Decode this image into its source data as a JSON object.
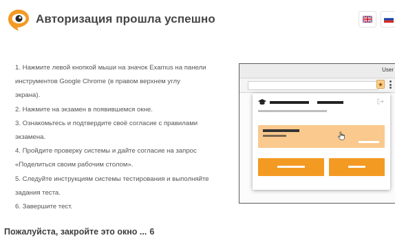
{
  "header": {
    "title": "Авторизация прошла успешно",
    "languages": [
      {
        "code": "en",
        "icon": "uk-flag-icon"
      },
      {
        "code": "ru",
        "icon": "russia-flag-icon"
      }
    ]
  },
  "instructions": [
    "1. Нажмите левой кнопкой мыши на значок Examus на панели",
    "инструментов Google Chrome (в правом верхнем углу",
    "экрана).",
    "2. Нажмите на экзамен в появившемся окне.",
    "3. Ознакомьтесь и подтвердите своё согласие с правилами",
    "экзамена.",
    "4. Пройдите проверку системы и дайте согласие на запрос",
    "«Поделиться своим рабочим столом».",
    "5. Следуйте инструкциям системы тестирования и выполняйте",
    "задания теста.",
    "6. Завершите тест."
  ],
  "footer": {
    "closing_text": "Пожалуйста, закройте это окно ...",
    "countdown": "6"
  },
  "illustration": {
    "user_label": "User"
  },
  "colors": {
    "accent_orange": "#f39a23",
    "card_peach": "#f9c98d",
    "title_gray": "#454545"
  }
}
